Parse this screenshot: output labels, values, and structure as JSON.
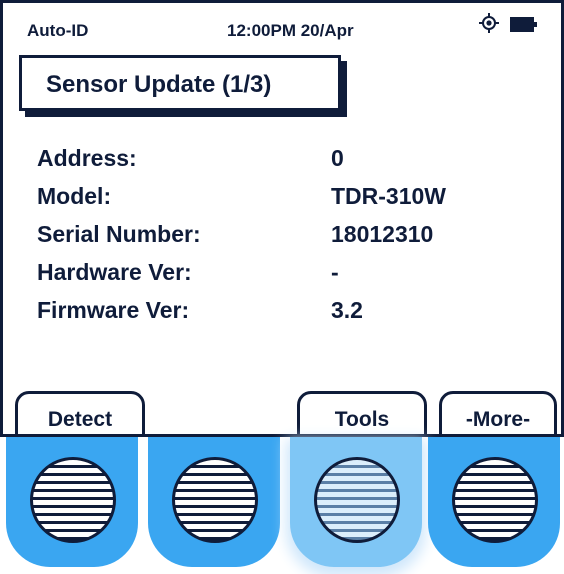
{
  "status_bar": {
    "mode": "Auto-ID",
    "datetime": "12:00PM 20/Apr",
    "icons": [
      "gps-icon",
      "battery-icon"
    ]
  },
  "title": "Sensor Update (1/3)",
  "info": [
    {
      "label": "Address:",
      "value": "0"
    },
    {
      "label": "Model:",
      "value": "TDR-310W"
    },
    {
      "label": "Serial Number:",
      "value": "18012310"
    },
    {
      "label": "Hardware Ver:",
      "value": "-"
    },
    {
      "label": "Firmware Ver:",
      "value": "3.2"
    }
  ],
  "softkeys": {
    "key1": "Detect",
    "key2": "",
    "key3": "Tools",
    "key4": "-More-"
  },
  "hardware_keys": {
    "pressed_index": 3,
    "color": "#3aa6f1"
  },
  "colors": {
    "ink": "#0f1c3a",
    "key_blue": "#3aa6f1"
  }
}
